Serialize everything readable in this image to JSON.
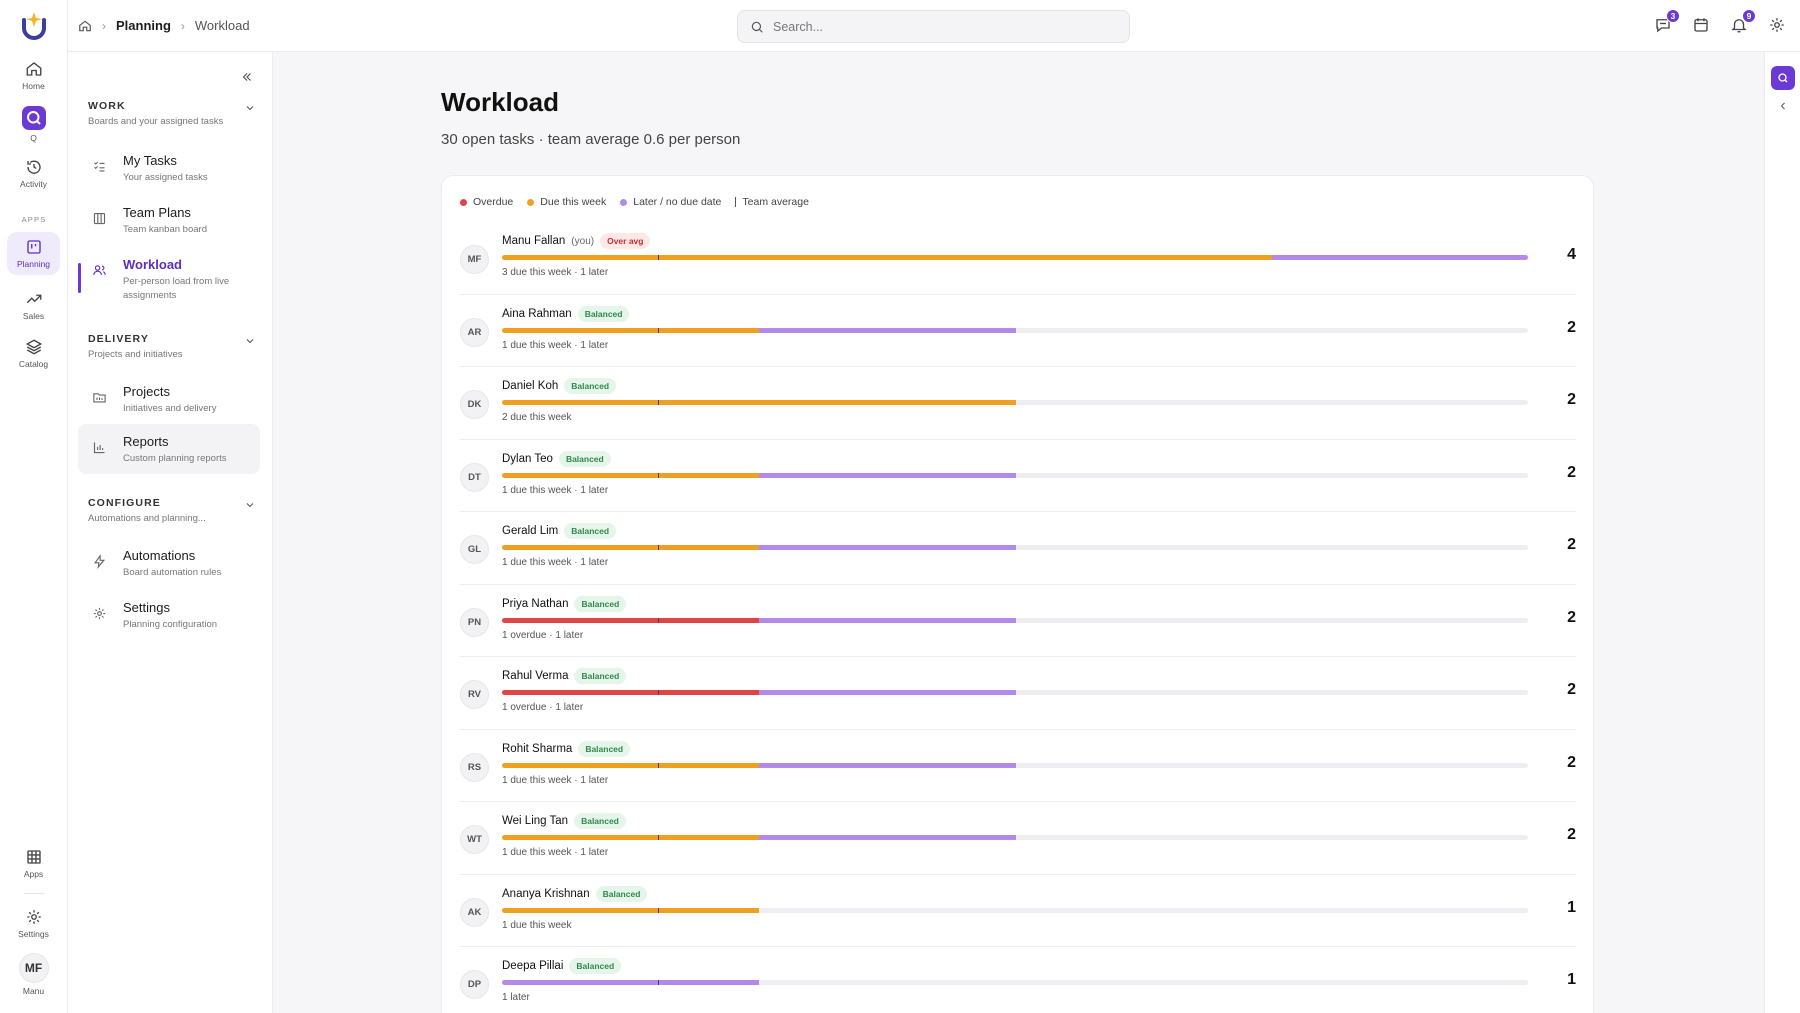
{
  "rail": {
    "items": [
      {
        "label": "Home",
        "icon": "home-icon"
      },
      {
        "label": "Q",
        "icon": "q-app-icon"
      },
      {
        "label": "Activity",
        "icon": "history-icon"
      },
      {
        "label": "Planning",
        "icon": "planning-icon"
      },
      {
        "label": "Sales",
        "icon": "trend-up-icon"
      },
      {
        "label": "Catalog",
        "icon": "layers-icon"
      },
      {
        "label": "Apps",
        "icon": "grid-icon"
      },
      {
        "label": "Settings",
        "icon": "gear-icon"
      },
      {
        "label": "Manu",
        "icon": "avatar"
      }
    ],
    "apps_section": "APPS",
    "avatar_initials": "MF"
  },
  "breadcrumb": {
    "section": "Planning",
    "page": "Workload"
  },
  "search": {
    "placeholder": "Search..."
  },
  "header_badges": {
    "messages": "3",
    "notifications": "9"
  },
  "sidenav": {
    "sections": [
      {
        "title": "WORK",
        "subtitle": "Boards and your assigned tasks"
      },
      {
        "title": "DELIVERY",
        "subtitle": "Projects and initiatives"
      },
      {
        "title": "CONFIGURE",
        "subtitle": "Automations and planning..."
      }
    ],
    "items": [
      {
        "label": "My Tasks",
        "sub": "Your assigned tasks"
      },
      {
        "label": "Team Plans",
        "sub": "Team kanban board"
      },
      {
        "label": "Workload",
        "sub": "Per-person load from live assignments"
      },
      {
        "label": "Projects",
        "sub": "Initiatives and delivery"
      },
      {
        "label": "Reports",
        "sub": "Custom planning reports"
      },
      {
        "label": "Automations",
        "sub": "Board automation rules"
      },
      {
        "label": "Settings",
        "sub": "Planning configuration"
      }
    ]
  },
  "page": {
    "title": "Workload",
    "subtitle": "30 open tasks · team average 0.6 per person"
  },
  "legend": {
    "overdue": "Overdue",
    "due_week": "Due this week",
    "later": "Later / no due date",
    "team_avg": "Team average"
  },
  "colors": {
    "overdue": "#e04444",
    "due_week": "#f0a020",
    "later": "#b48ae8",
    "accent": "#6b3ad6"
  },
  "people": [
    {
      "initials": "MF",
      "name": "Manu Fallan",
      "you": "(you)",
      "status": "Over avg",
      "overdue": 0,
      "due_week": 3,
      "later": 1,
      "detail": "3 due this week · 1 later",
      "count": "4"
    },
    {
      "initials": "AR",
      "name": "Aina Rahman",
      "status": "Balanced",
      "overdue": 0,
      "due_week": 1,
      "later": 1,
      "detail": "1 due this week · 1 later",
      "count": "2"
    },
    {
      "initials": "DK",
      "name": "Daniel Koh",
      "status": "Balanced",
      "overdue": 0,
      "due_week": 2,
      "later": 0,
      "detail": "2 due this week",
      "count": "2"
    },
    {
      "initials": "DT",
      "name": "Dylan Teo",
      "status": "Balanced",
      "overdue": 0,
      "due_week": 1,
      "later": 1,
      "detail": "1 due this week · 1 later",
      "count": "2"
    },
    {
      "initials": "GL",
      "name": "Gerald Lim",
      "status": "Balanced",
      "overdue": 0,
      "due_week": 1,
      "later": 1,
      "detail": "1 due this week · 1 later",
      "count": "2"
    },
    {
      "initials": "PN",
      "name": "Priya Nathan",
      "status": "Balanced",
      "overdue": 1,
      "due_week": 0,
      "later": 1,
      "detail": "1 overdue · 1 later",
      "count": "2"
    },
    {
      "initials": "RV",
      "name": "Rahul Verma",
      "status": "Balanced",
      "overdue": 1,
      "due_week": 0,
      "later": 1,
      "detail": "1 overdue · 1 later",
      "count": "2"
    },
    {
      "initials": "RS",
      "name": "Rohit Sharma",
      "status": "Balanced",
      "overdue": 0,
      "due_week": 1,
      "later": 1,
      "detail": "1 due this week · 1 later",
      "count": "2"
    },
    {
      "initials": "WT",
      "name": "Wei Ling Tan",
      "status": "Balanced",
      "overdue": 0,
      "due_week": 1,
      "later": 1,
      "detail": "1 due this week · 1 later",
      "count": "2"
    },
    {
      "initials": "AK",
      "name": "Ananya Krishnan",
      "status": "Balanced",
      "overdue": 0,
      "due_week": 1,
      "later": 0,
      "detail": "1 due this week",
      "count": "1"
    },
    {
      "initials": "DP",
      "name": "Deepa Pillai",
      "status": "Balanced",
      "overdue": 0,
      "due_week": 0,
      "later": 1,
      "detail": "1 later",
      "count": "1"
    }
  ]
}
